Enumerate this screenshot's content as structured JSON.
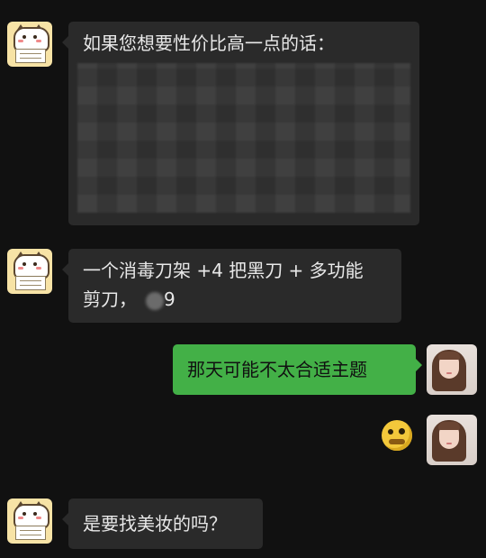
{
  "messages": [
    {
      "side": "left",
      "avatar": "cat-avatar",
      "text": "如果您想要性价比高一点的话："
    },
    {
      "side": "left",
      "avatar": "cat-avatar",
      "text_line1": "一个消毒刀架 +4 把黑刀 + 多功能",
      "text_line2": "剪刀，",
      "text_tail": "9"
    },
    {
      "side": "right",
      "avatar": "girl-avatar",
      "text": "那天可能不太合适主题"
    },
    {
      "side": "right",
      "avatar": "girl-avatar",
      "sticker": "yellow-emoji-sticker"
    },
    {
      "side": "left",
      "avatar": "cat-avatar",
      "text": "是要找美妆的吗？"
    }
  ],
  "colors": {
    "background": "#111111",
    "incoming_bubble": "#2a2a2a",
    "outgoing_bubble": "#43b047"
  }
}
